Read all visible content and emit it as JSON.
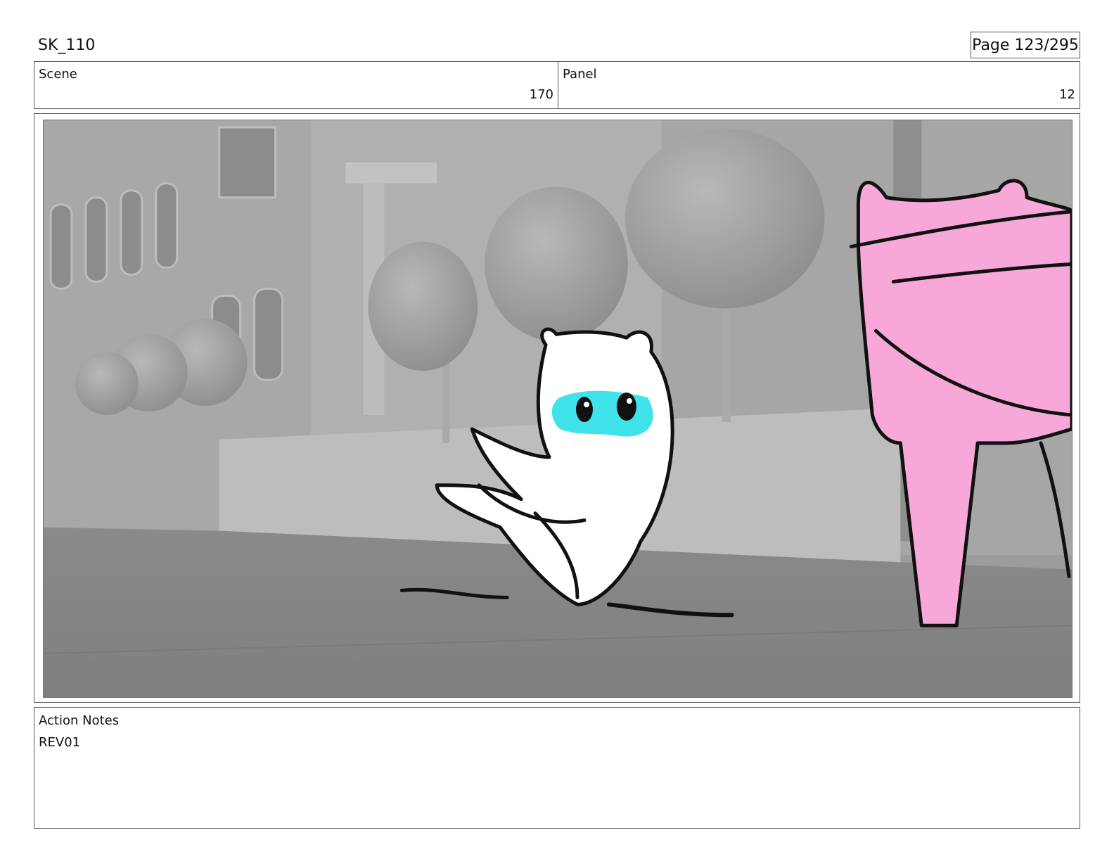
{
  "header": {
    "title": "SK_110",
    "page": "Page 123/295"
  },
  "scene": {
    "label": "Scene",
    "value": "170"
  },
  "panel": {
    "label": "Panel",
    "value": "12"
  },
  "notes": {
    "label": "Action Notes",
    "text": "REV01"
  },
  "colors": {
    "character_eye_accent": "#3fe3ea",
    "prop_pink": "#f8a8d8",
    "background_gray": "#9c9c9c"
  }
}
